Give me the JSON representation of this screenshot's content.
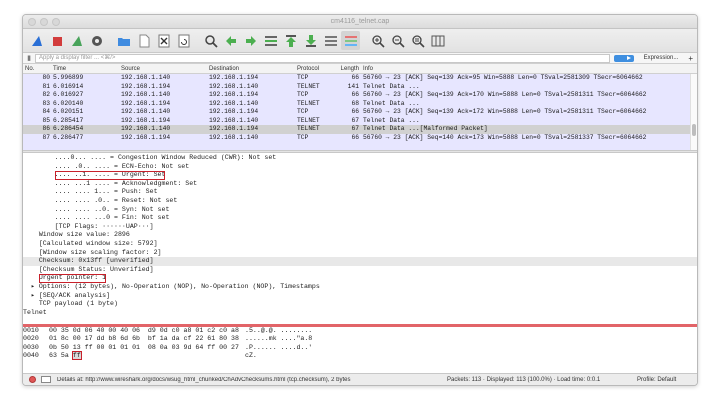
{
  "window": {
    "title": "cm4116_telnet.cap"
  },
  "filter": {
    "placeholder": "Apply a display filter ... <⌘/>",
    "expression_label": "Expression...",
    "plus_label": "+"
  },
  "columns": [
    "No.",
    "Time",
    "Source",
    "Destination",
    "Protocol",
    "Length",
    "Info"
  ],
  "packets": [
    {
      "no": "80",
      "time": "5.996899",
      "src": "192.168.1.140",
      "dst": "192.168.1.194",
      "proto": "TCP",
      "len": "66",
      "info": "56760 → 23 [ACK] Seq=139 Ack=95 Win=5888 Len=0 TSval=2581309 TSecr=6064662"
    },
    {
      "no": "81",
      "time": "6.016914",
      "src": "192.168.1.194",
      "dst": "192.168.1.140",
      "proto": "TELNET",
      "len": "141",
      "info": "Telnet Data ..."
    },
    {
      "no": "82",
      "time": "6.016927",
      "src": "192.168.1.140",
      "dst": "192.168.1.194",
      "proto": "TCP",
      "len": "66",
      "info": "56760 → 23 [ACK] Seq=139 Ack=170 Win=5888 Len=0 TSval=2581311 TSecr=6064662"
    },
    {
      "no": "83",
      "time": "6.020140",
      "src": "192.168.1.194",
      "dst": "192.168.1.140",
      "proto": "TELNET",
      "len": "68",
      "info": "Telnet Data ..."
    },
    {
      "no": "84",
      "time": "6.020151",
      "src": "192.168.1.140",
      "dst": "192.168.1.194",
      "proto": "TCP",
      "len": "66",
      "info": "56760 → 23 [ACK] Seq=139 Ack=172 Win=5888 Len=0 TSval=2581311 TSecr=6064662"
    },
    {
      "no": "85",
      "time": "6.285417",
      "src": "192.168.1.194",
      "dst": "192.168.1.140",
      "proto": "TELNET",
      "len": "67",
      "info": "Telnet Data ..."
    },
    {
      "no": "86",
      "time": "6.286454",
      "src": "192.168.1.140",
      "dst": "192.168.1.194",
      "proto": "TELNET",
      "len": "67",
      "info": "Telnet Data ...[Malformed Packet]",
      "selected": true
    },
    {
      "no": "87",
      "time": "6.286477",
      "src": "192.168.1.194",
      "dst": "192.168.1.140",
      "proto": "TCP",
      "len": "66",
      "info": "56760 → 23 [ACK] Seq=140 Ack=173 Win=5888 Len=0 TSval=2581337 TSecr=6064662"
    }
  ],
  "details": [
    {
      "text": "        ....0... .... = Congestion Window Reduced (CWR): Not set"
    },
    {
      "text": "        .... .0.. .... = ECN-Echo: Not set"
    },
    {
      "text": "        .... ..1. .... = Urgent: Set",
      "boxed": true
    },
    {
      "text": "        .... ...1 .... = Acknowledgment: Set"
    },
    {
      "text": "        .... .... 1... = Push: Set"
    },
    {
      "text": "        .... .... .0.. = Reset: Not set"
    },
    {
      "text": "        .... .... ..0. = Syn: Not set"
    },
    {
      "text": "        .... .... ...0 = Fin: Not set"
    },
    {
      "text": "        [TCP Flags: ······UAP···]"
    },
    {
      "text": "    Window size value: 2896"
    },
    {
      "text": "    [Calculated window size: 5792]"
    },
    {
      "text": "    [Window size scaling factor: 2]"
    },
    {
      "text": "    Checksum: 0x13ff [unverified]",
      "bg": true
    },
    {
      "text": "    [Checksum Status: Unverified]"
    },
    {
      "text": "    Urgent pointer: 1",
      "boxed": true
    },
    {
      "text": "  ▸ Options: (12 bytes), No-Operation (NOP), No-Operation (NOP), Timestamps"
    },
    {
      "text": "  ▸ [SEQ/ACK analysis]"
    },
    {
      "text": "    TCP payload (1 byte)"
    },
    {
      "text": "Telnet"
    }
  ],
  "hex": [
    {
      "off": "0010",
      "bytes": "00 35 0d 06 40 00 40 06  d9 0d c0 a8 01 c2 c0 a8",
      "ascii": ".5..@.@. ........"
    },
    {
      "off": "0020",
      "bytes": "01 8c 00 17 dd b8 6d 6b  bf 1a da cf 22 61 80 38",
      "ascii": "......mk ....\"a.8"
    },
    {
      "off": "0030",
      "bytes": "0b 50 13 ff 00 01 01 01  08 0a 03 9d 64 ff 00 27",
      "ascii": ".P...... ....d..'"
    },
    {
      "off": "0040",
      "bytes_pre": "63 5a ",
      "bytes_mark": "ff",
      "bytes_post": "",
      "ascii": "cZ."
    }
  ],
  "status": {
    "details": "Details at: http://www.wireshark.org/docs/wsug_html_chunked/ChAdvChecksums.html (tcp.checksum), 2 bytes",
    "packets": "Packets: 113 · Displayed: 113 (100.0%) · Load time: 0:0.1",
    "profile": "Profile: Default"
  },
  "colors": {
    "selected_row": "#d1d1d1",
    "tcp_row": "#e7e6ff",
    "highlight_box": "#c8202a"
  }
}
